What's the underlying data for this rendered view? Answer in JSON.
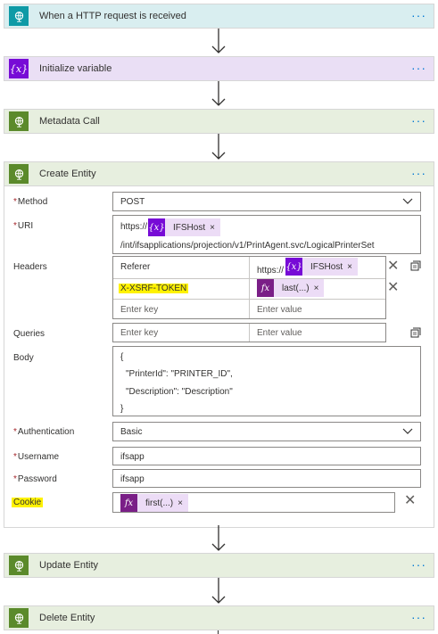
{
  "steps": {
    "http_request": {
      "title": "When a HTTP request is received",
      "icon": "globe-icon",
      "more": "···"
    },
    "init_variable": {
      "title": "Initialize variable",
      "icon": "variable-icon",
      "icon_glyph": "{x}",
      "more": "···"
    },
    "metadata_call": {
      "title": "Metadata Call",
      "icon": "globe-icon",
      "more": "···"
    },
    "create_entity": {
      "title": "Create Entity",
      "icon": "globe-icon",
      "more": "···"
    },
    "update_entity": {
      "title": "Update Entity",
      "icon": "globe-icon",
      "more": "···"
    },
    "delete_entity": {
      "title": "Delete Entity",
      "icon": "globe-icon",
      "more": "···"
    }
  },
  "create": {
    "method": {
      "label": "Method",
      "value": "POST"
    },
    "uri": {
      "label": "URI",
      "prefix": "https://",
      "token": "IFSHost",
      "suffix": "/int/ifsapplications/projection/v1/PrintAgent.svc/LogicalPrinterSet"
    },
    "headers": {
      "label": "Headers",
      "rows": [
        {
          "key": "Referer",
          "value_prefix": "https://",
          "value_token": "IFSHost"
        },
        {
          "key": "X-XSRF-TOKEN",
          "value_token": "last(...)"
        }
      ],
      "key_placeholder": "Enter key",
      "value_placeholder": "Enter value"
    },
    "queries": {
      "label": "Queries",
      "key_placeholder": "Enter key",
      "value_placeholder": "Enter value"
    },
    "body": {
      "label": "Body",
      "lines": [
        "{",
        "\"PrinterId\": \"PRINTER_ID\",",
        "\"Description\": \"Description\"",
        "}"
      ]
    },
    "authentication": {
      "label": "Authentication",
      "value": "Basic"
    },
    "username": {
      "label": "Username",
      "value": "ifsapp"
    },
    "password": {
      "label": "Password",
      "value": "ifsapp"
    },
    "cookie": {
      "label": "Cookie",
      "token": "first(...)"
    }
  },
  "glyphs": {
    "required": "*",
    "remove": "×",
    "close": "✕",
    "fx": "fx",
    "var": "{x}"
  },
  "colors": {
    "accent": "#0078d4",
    "variable": "#770bd6",
    "http": "#0f9aa6",
    "action": "#5b8a2b",
    "highlight": "#fff200"
  }
}
